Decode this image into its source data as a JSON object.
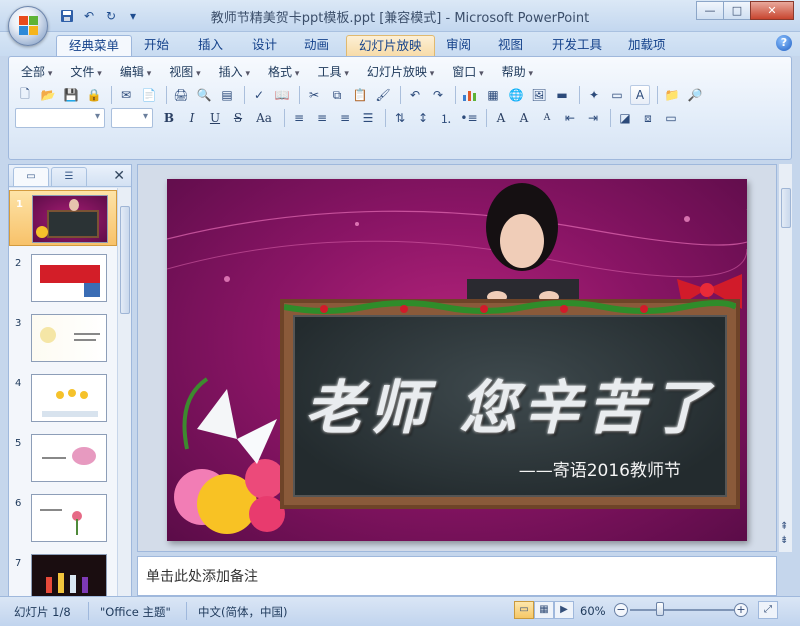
{
  "window": {
    "title": "教师节精美贺卡ppt模板.ppt [兼容模式] - Microsoft PowerPoint",
    "minimize_icon": "minimize-icon",
    "maximize_icon": "maximize-icon",
    "close_icon": "close-icon"
  },
  "quick_access": [
    "save-icon",
    "undo-icon",
    "redo-icon",
    "customize-icon"
  ],
  "ribbon_tabs": [
    {
      "label": "经典菜单",
      "active": true
    },
    {
      "label": "开始"
    },
    {
      "label": "插入"
    },
    {
      "label": "设计"
    },
    {
      "label": "动画"
    },
    {
      "label": "幻灯片放映",
      "highlight": true
    },
    {
      "label": "审阅"
    },
    {
      "label": "视图"
    },
    {
      "label": "开发工具"
    },
    {
      "label": "加载项"
    }
  ],
  "classic_menu": [
    "全部",
    "文件",
    "编辑",
    "视图",
    "插入",
    "格式",
    "工具",
    "幻灯片放映",
    "窗口",
    "帮助"
  ],
  "format_buttons": {
    "bold": "B",
    "italic": "I",
    "underline": "U",
    "strike": "S",
    "case": "Aa"
  },
  "slides_pane": {
    "slides": [
      {
        "num": "1"
      },
      {
        "num": "2"
      },
      {
        "num": "3"
      },
      {
        "num": "4"
      },
      {
        "num": "5"
      },
      {
        "num": "6"
      },
      {
        "num": "7"
      }
    ]
  },
  "slide": {
    "title": "老师 您辛苦了",
    "subtitle": "——寄语2016教师节"
  },
  "notes_placeholder": "单击此处添加备注",
  "status": {
    "slide_info": "幻灯片 1/8",
    "theme": "\"Office 主题\"",
    "language": "中文(简体，中国)",
    "zoom": "60%"
  },
  "colors": {
    "slide_background": "#8b1566",
    "board": "#2e3638",
    "ribbon_accent": "#15428b"
  }
}
